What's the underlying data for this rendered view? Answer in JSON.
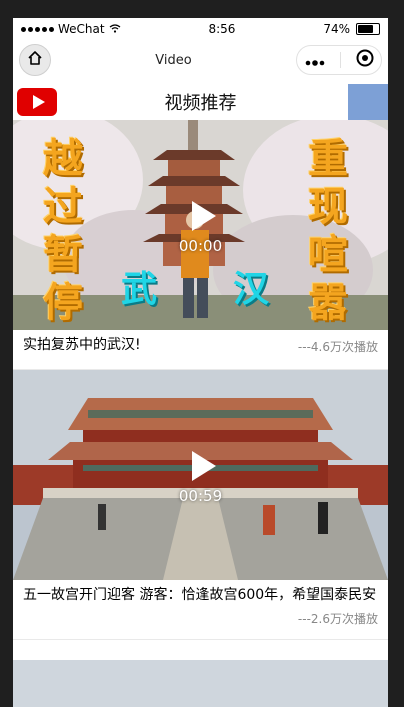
{
  "statusbar": {
    "carrier": "WeChat",
    "time": "8:56",
    "battery": "74%"
  },
  "navbar": {
    "title": "Video"
  },
  "header": {
    "title": "视频推荐"
  },
  "videos": [
    {
      "overlay_left": [
        "越",
        "过",
        "暂",
        "停"
      ],
      "overlay_right": [
        "重",
        "现",
        "喧",
        "嚣"
      ],
      "overlay_center": [
        "武",
        "汉"
      ],
      "duration": "00:00",
      "title": "实拍复苏中的武汉!",
      "plays": "---4.6万次播放"
    },
    {
      "duration": "00:59",
      "title": "五一故宫开门迎客 游客：恰逢故宫600年，希望国泰民安",
      "plays": "---2.6万次播放"
    }
  ],
  "colors": {
    "accent_red": "#e00000",
    "gold": "#f4a51f",
    "cyan": "#20d5e6"
  },
  "icons": [
    "home-icon",
    "more-icon",
    "record-icon",
    "youtube-logo-icon",
    "play-icon"
  ]
}
